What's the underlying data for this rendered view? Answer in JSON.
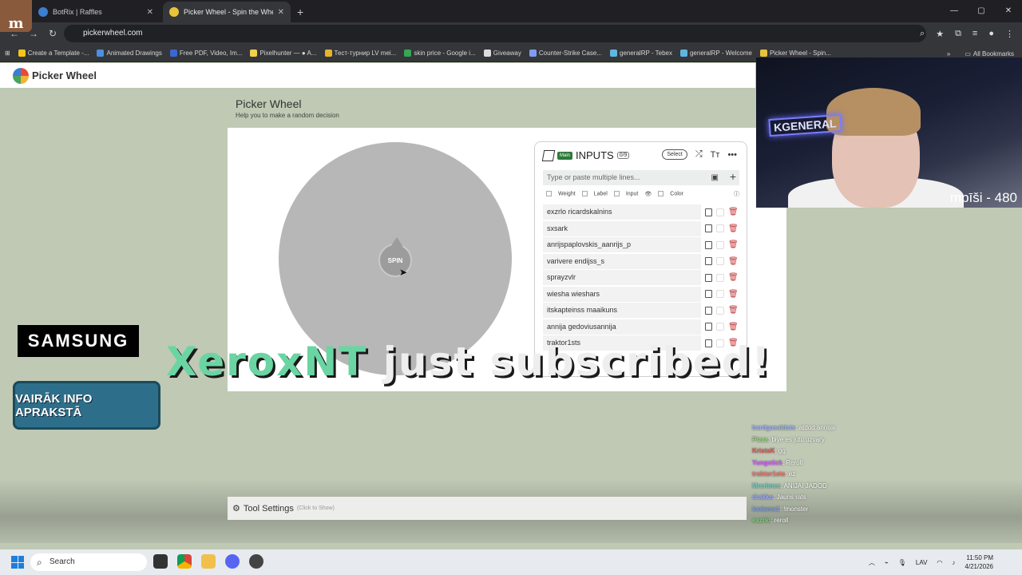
{
  "browser": {
    "tabs": [
      {
        "title": "BotRix | Raffles",
        "active": false
      },
      {
        "title": "Picker Wheel - Spin the Wheel",
        "active": true
      }
    ],
    "url": "pickerwheel.com",
    "bookmarks": [
      "Create a Template -...",
      "Animated Drawings",
      "Free PDF, Video, Im...",
      "Pixelhunter — ● A...",
      "Тест-турнир LV mei...",
      "skin price - Google i...",
      "Giveaway",
      "Counter-Strike Case...",
      "generalRP - Tebex",
      "generalRP - Welcome",
      "Picker Wheel - Spin..."
    ],
    "all_bookmarks": "All Bookmarks"
  },
  "site": {
    "logo": "Picker Wheel",
    "title": "Picker Wheel",
    "subtitle": "Help you to make a random decision",
    "spin_label": "SPIN",
    "inputs": {
      "badge": "Main",
      "title": "INPUTS",
      "count": "0/9",
      "select_label": "Select",
      "placeholder": "Type or paste multiple lines...",
      "options": [
        "Weight",
        "Label",
        "Input",
        "Color"
      ],
      "entries": [
        "exzrlo ricardskalnins",
        "sxsark",
        "anrijspaplovskis_aanrijs_p",
        "varivere endijss_s",
        "sprayzvlr",
        "wiesha wieshars",
        "itskapteinss maaikuns",
        "annija gedoviusannija",
        "traktor1sts"
      ]
    },
    "settings_label": "Tool Settings",
    "settings_hint": "(Click to Show)"
  },
  "overlay": {
    "subscriber": "XeroxNT",
    "sub_text": "just subscribed!",
    "samsung": "SAMSUNG",
    "info_button": "VAIRĀK INFO APRAKSTĀ",
    "webcam_sign": "KGENERAL",
    "webcam_counter": "mpīši - 480",
    "chat": [
      {
        "user": "bardgasaldats",
        "msg": "atdod annijai",
        "color": "#9db3ff"
      },
      {
        "user": "Pizza",
        "msg": "blye es jutu uzvary",
        "color": "#8be26b"
      },
      {
        "user": "KristsK",
        "msg": "gg",
        "color": "#e05a5a"
      },
      {
        "user": "Yungstick",
        "msg": "Reroll",
        "color": "#d55cff"
      },
      {
        "user": "traktor1sts",
        "msg": "ez",
        "color": "#ff6a6a"
      },
      {
        "user": "Mrcrimes",
        "msg": "ANIJAI JADOD",
        "color": "#6fd0c0"
      },
      {
        "user": "drakko",
        "msg": "Jauns rats",
        "color": "#9aa7ff"
      },
      {
        "user": "lonisms1",
        "msg": "!monster",
        "color": "#7fa2e0"
      },
      {
        "user": "exzrlo",
        "msg": "reroll",
        "color": "#6adf6a"
      }
    ]
  },
  "taskbar": {
    "search": "Search",
    "language": "LAV",
    "time": "11:50 PM",
    "date": "4/21/2026"
  }
}
